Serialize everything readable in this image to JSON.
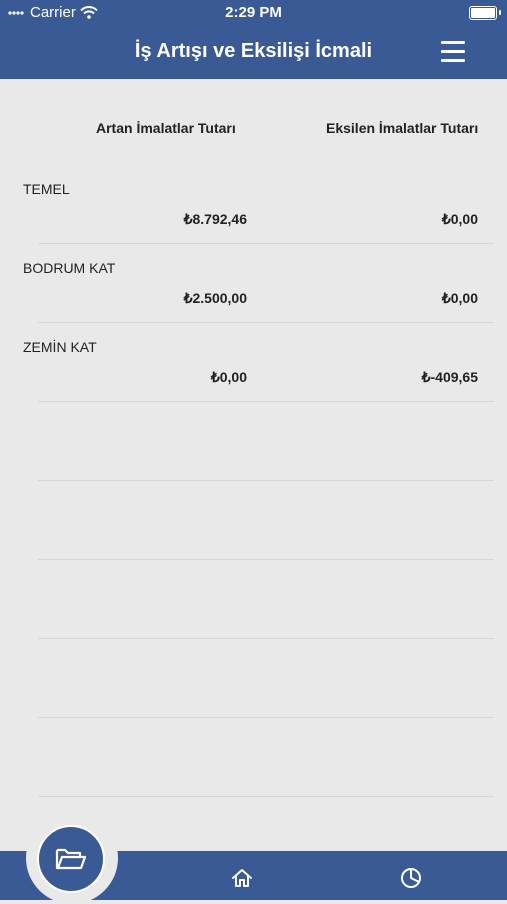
{
  "status_bar": {
    "carrier": "Carrier",
    "time": "2:29 PM"
  },
  "header": {
    "title": "İş Artışı ve Eksilişi İcmali"
  },
  "columns": {
    "increase": "Artan İmalatlar Tutarı",
    "decrease": "Eksilen İmalatlar Tutarı"
  },
  "rows": [
    {
      "label": "TEMEL",
      "increase": "₺8.792,46",
      "decrease": "₺0,00"
    },
    {
      "label": "BODRUM KAT",
      "increase": "₺2.500,00",
      "decrease": "₺0,00"
    },
    {
      "label": "ZEMİN KAT",
      "increase": "₺0,00",
      "decrease": "₺-409,65"
    }
  ],
  "icons": {
    "menu": "hamburger-menu-icon",
    "fab": "open-folder-icon",
    "home": "home-icon",
    "report": "pie-chart-icon",
    "wifi": "wifi-icon",
    "battery": "battery-icon"
  },
  "colors": {
    "primary": "#3a5a96",
    "background": "#e9e9e9"
  }
}
